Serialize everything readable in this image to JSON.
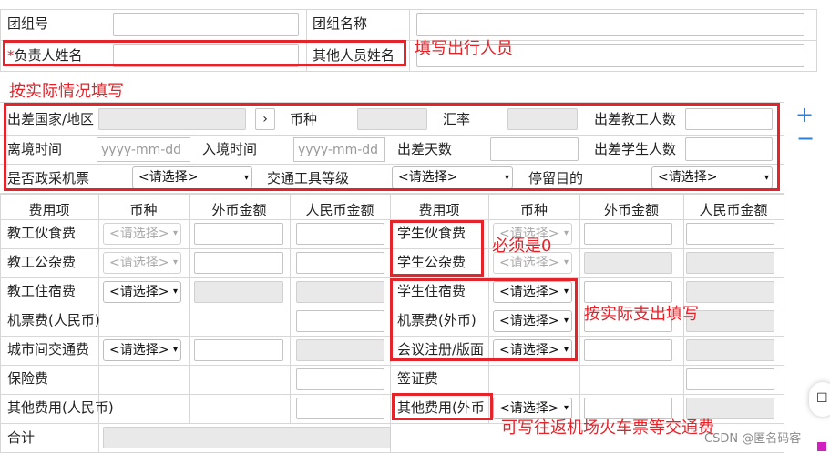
{
  "top": {
    "group_no": "团组号",
    "group_name": "团组名称",
    "required_star": "*",
    "leader_name": "负责人姓名",
    "others_name": "其他人员姓名"
  },
  "trip": {
    "country": "出差国家/地区",
    "currency": "币种",
    "rate": "汇率",
    "teacher_count": "出差教工人数",
    "depart": "离境时间",
    "enter": "入境时间",
    "days": "出差天数",
    "student_count": "出差学生人数",
    "gov_ticket": "是否政采机票",
    "transport_level": "交通工具等级",
    "stay_purpose": "停留目的",
    "date_placeholder": "yyyy-mm-dd",
    "select_placeholder": "<请选择>",
    "picker_arrow": "›"
  },
  "costs": {
    "headers": [
      "费用项",
      "币种",
      "外币金额",
      "人民币金额",
      "费用项",
      "币种",
      "外币金额",
      "人民币金额"
    ],
    "left_items": [
      "教工伙食费",
      "教工公杂费",
      "教工住宿费",
      "机票费(人民币)",
      "城市间交通费",
      "保险费",
      "其他费用(人民币)"
    ],
    "right_items": [
      "学生伙食费",
      "学生公杂费",
      "学生住宿费",
      "机票费(外币)",
      "会议注册/版面",
      "签证费",
      "其他费用(外币"
    ],
    "total": "合计"
  },
  "annotations": {
    "fill_travelers": "填写出行人员",
    "fill_actual": "按实际情况填写",
    "must_zero": "必须是0",
    "actual_expense": "按实际支出填写",
    "round_trip": "可写往返机场火车票等交通费"
  },
  "controls": {
    "plus": "+",
    "minus": "−",
    "dropdown_arrow": "▾",
    "side_icon": "☐"
  },
  "watermark": "CSDN @匿名码客"
}
